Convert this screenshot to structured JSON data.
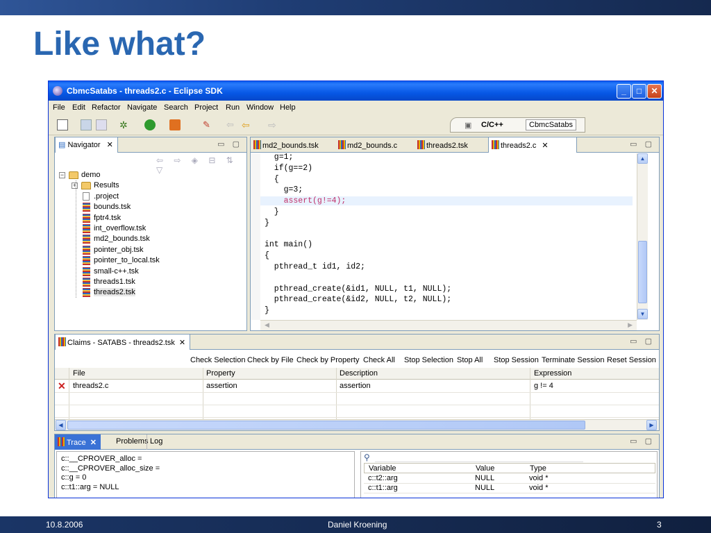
{
  "slide": {
    "title": "Like what?",
    "footer_date": "10.8.2006",
    "footer_author": "Daniel Kroening",
    "footer_page": "3"
  },
  "window": {
    "title": "CbmcSatabs - threads2.c - Eclipse SDK",
    "minimize": "_",
    "maximize": "□",
    "close": "✕"
  },
  "menu": [
    "File",
    "Edit",
    "Refactor",
    "Navigate",
    "Search",
    "Project",
    "Run",
    "Window",
    "Help"
  ],
  "perspectives": {
    "cpp": "C/C++",
    "cbmc": "CbmcSatabs"
  },
  "navigator": {
    "tab": "Navigator",
    "items": [
      {
        "label": "demo",
        "type": "project"
      },
      {
        "label": "Results",
        "type": "folder"
      },
      {
        "label": ".project",
        "type": "file"
      },
      {
        "label": "bounds.tsk",
        "type": "tsk"
      },
      {
        "label": "fptr4.tsk",
        "type": "tsk"
      },
      {
        "label": "int_overflow.tsk",
        "type": "tsk"
      },
      {
        "label": "md2_bounds.tsk",
        "type": "tsk"
      },
      {
        "label": "pointer_obj.tsk",
        "type": "tsk"
      },
      {
        "label": "pointer_to_local.tsk",
        "type": "tsk"
      },
      {
        "label": "small-c++.tsk",
        "type": "tsk"
      },
      {
        "label": "threads1.tsk",
        "type": "tsk"
      },
      {
        "label": "threads2.tsk",
        "type": "tsk"
      }
    ]
  },
  "editor": {
    "tabs": [
      "md2_bounds.tsk",
      "md2_bounds.c",
      "threads2.tsk",
      "threads2.c"
    ],
    "active_tab": "threads2.c",
    "lines": [
      "  g=1;",
      "  if(g==2)",
      "  {",
      "    g=3;",
      "    assert(g!=4);",
      "  }",
      "}",
      "",
      "int main()",
      "{",
      "  pthread_t id1, id2;",
      "",
      "  pthread_create(&id1, NULL, t1, NULL);",
      "  pthread_create(&id2, NULL, t2, NULL);",
      "}"
    ],
    "highlight_line": 4,
    "highlight_color": "#e8f2fe",
    "assert_color": "#c0306a"
  },
  "claims": {
    "tab": "Claims - SATABS - threads2.tsk",
    "buttons": [
      "Check Selection",
      "Check by File",
      "Check by Property",
      "Check All",
      "Stop Selection",
      "Stop All",
      "Stop Session",
      "Terminate Session",
      "Reset Session"
    ],
    "columns": [
      "File",
      "Property",
      "Description",
      "Expression"
    ],
    "rows": [
      {
        "status": "✕",
        "file": "threads2.c",
        "property": "assertion",
        "description": "assertion",
        "expression": "g != 4"
      }
    ]
  },
  "trace": {
    "tabs": [
      "Trace",
      "Problems",
      "Log"
    ],
    "close_glyph": "✕",
    "lines": [
      "c::__CPROVER_alloc =",
      "c::__CPROVER_alloc_size =",
      "c::g = 0",
      "c::t1::arg = NULL"
    ],
    "var_columns": [
      "Variable",
      "Value",
      "Type"
    ],
    "vars": [
      {
        "variable": "c::t2::arg",
        "value": "NULL",
        "type": "void *"
      },
      {
        "variable": "c::t1::arg",
        "value": "NULL",
        "type": "void *"
      }
    ]
  },
  "colors": {
    "title_blue": "#2a67b1",
    "xp_title": "#0758e6",
    "error_red": "#cc2020"
  }
}
